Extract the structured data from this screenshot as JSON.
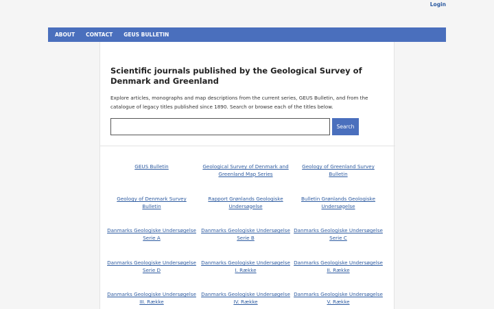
{
  "header": {
    "login_label": "Login"
  },
  "nav": {
    "items": [
      "ABOUT",
      "CONTACT",
      "GEUS BULLETIN"
    ]
  },
  "main": {
    "title": "Scientific journals published by the Geological Survey of Denmark and Greenland",
    "description": "Explore articles, monographs and map descriptions from the current series, GEUS Bulletin, and from the catalogue of legacy titles published since 1890. Search or browse each of the titles below.",
    "search": {
      "value": "",
      "button_label": "Search"
    },
    "journals": [
      "GEUS Bulletin",
      "Geological Survey of Denmark and Greenland Map Series",
      "Geology of Greenland Survey Bulletin",
      "Geology of Denmark Survey Bulletin",
      "Rapport Grønlands Geologiske Undersøgelse",
      "Bulletin Grønlands Geologiske Undersøgelse",
      "Danmarks Geologiske Undersøgelse Serie A",
      "Danmarks Geologiske Undersøgelse Serie B",
      "Danmarks Geologiske Undersøgelse Serie C",
      "Danmarks Geologiske Undersøgelse Serie D",
      "Danmarks Geologiske Undersøgelse I. Række",
      "Danmarks Geologiske Undersøgelse II. Række",
      "Danmarks Geologiske Undersøgelse III. Række",
      "Danmarks Geologiske Undersøgelse IV. Række",
      "Danmarks Geologiske Undersøgelse V. Række"
    ]
  }
}
